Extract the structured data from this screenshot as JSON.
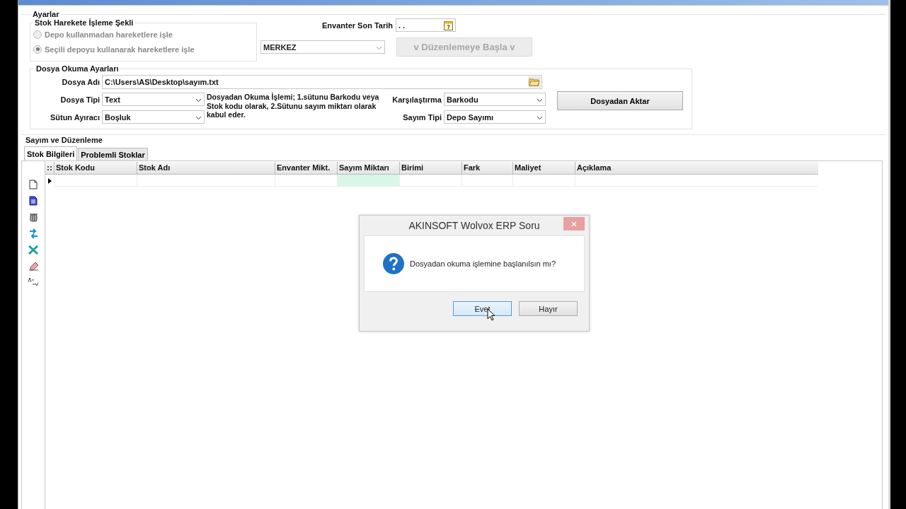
{
  "settings": {
    "title": "Ayarlar",
    "movement_mode": {
      "title": "Stok Harekete İşleme Şekli",
      "options": [
        {
          "label": "Depo kullanmadan hareketlere işle",
          "selected": false,
          "disabled": true
        },
        {
          "label": "Seçili depoyu kullanarak hareketlere işle",
          "selected": true,
          "disabled": true
        }
      ]
    },
    "inventory_date": {
      "label": "Envanter Son Tarih",
      "value": ". ."
    },
    "warehouse": {
      "value": "MERKEZ",
      "disabled": true
    },
    "start_button": {
      "label": "v Düzenlemeye Başla v",
      "disabled": true
    },
    "file_settings": {
      "title": "Dosya Okuma Ayarları",
      "file_name": {
        "label": "Dosya Adı",
        "value": "C:\\Users\\AS\\Desktop\\sayım.txt"
      },
      "file_type": {
        "label": "Dosya Tipi",
        "value": "Text"
      },
      "separator": {
        "label": "Sütun Ayıracı",
        "value": "Boşluk"
      },
      "note": "Dosyadan Okuma İşlemi; 1.sütunu Barkodu veya Stok kodu olarak, 2.Sütunu sayım miktarı olarak kabul eder.",
      "comparison": {
        "label": "Karşılaştırma",
        "value": "Barkodu"
      },
      "count_type": {
        "label": "Sayım Tipi",
        "value": "Depo Sayımı"
      },
      "import_button": "Dosyadan Aktar"
    }
  },
  "counting": {
    "title": "Sayım ve Düzenleme",
    "tabs": [
      {
        "label": "Stok Bilgileri",
        "selected": true
      },
      {
        "label": "Problemli Stoklar",
        "selected": false
      }
    ],
    "columns": [
      {
        "label": "Stok Kodu",
        "highlighted": false
      },
      {
        "label": "Stok Adı",
        "highlighted": false
      },
      {
        "label": "Envanter Mikt.",
        "highlighted": false
      },
      {
        "label": "Sayım Miktarı",
        "highlighted": true
      },
      {
        "label": "Birimi",
        "highlighted": false
      },
      {
        "label": "Fark",
        "highlighted": false
      },
      {
        "label": "Maliyet",
        "highlighted": false
      },
      {
        "label": "Açıklama",
        "highlighted": false
      }
    ],
    "rows": [
      {
        "current": true
      }
    ]
  },
  "dialog": {
    "title": "AKINSOFT Wolvox ERP Soru",
    "message": "Dosyadan okuma işlemine başlanılsın mı?",
    "buttons": [
      {
        "label": "Evet",
        "selected": true
      },
      {
        "label": "Hayır",
        "selected": false
      }
    ]
  }
}
